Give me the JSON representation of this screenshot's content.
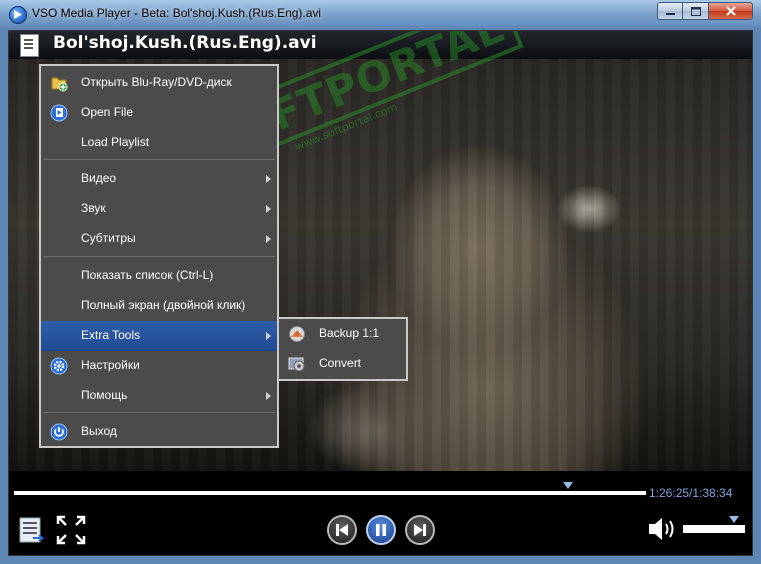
{
  "window": {
    "title": "VSO Media Player - Beta: Bol'shoj.Kush.(Rus.Eng).avi"
  },
  "header": {
    "file_title": "Bol'shoj.Kush.(Rus.Eng).avi"
  },
  "watermark": {
    "brand": "SOFTPORTAL",
    "url": "www.softportal.com",
    "tm": "TM"
  },
  "menu": {
    "items": [
      {
        "label": "Открыть Blu-Ray/DVD-диск",
        "icon": "folder-add-icon"
      },
      {
        "label": "Open File",
        "icon": "open-file-icon"
      },
      {
        "label": "Load Playlist",
        "icon": ""
      },
      {
        "label": "Видео",
        "has_submenu": true
      },
      {
        "label": "Звук",
        "has_submenu": true
      },
      {
        "label": "Субтитры",
        "has_submenu": true
      },
      {
        "label": "Показать список (Ctrl-L)"
      },
      {
        "label": "Полный экран (двойной клик)"
      },
      {
        "label": "Extra Tools",
        "has_submenu": true,
        "highlighted": true
      },
      {
        "label": "Настройки",
        "icon": "gear-icon"
      },
      {
        "label": "Помощь",
        "has_submenu": true
      },
      {
        "label": "Выход",
        "icon": "power-icon"
      }
    ]
  },
  "submenu": {
    "items": [
      {
        "label": "Backup 1:1",
        "icon": "backup-disc-icon"
      },
      {
        "label": "Convert",
        "icon": "convert-icon"
      }
    ]
  },
  "playback": {
    "time_display": "1:26:25/1:38:34",
    "progress_fraction": 0.877,
    "volume_fraction": 0.82
  },
  "colors": {
    "menu_highlight": "#2352a0",
    "time_text": "#7fa7e0",
    "marker": "#9bbbe6"
  }
}
